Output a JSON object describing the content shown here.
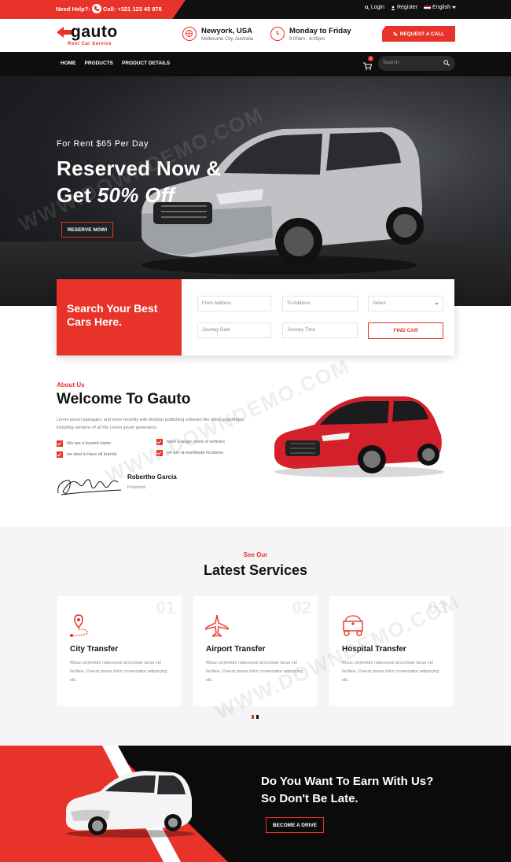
{
  "topbar": {
    "help_label": "Need Help?:",
    "phone": "Call: +321 123 45 978",
    "login": "Login",
    "register": "Register",
    "language": "English"
  },
  "header": {
    "logo_text": "gauto",
    "logo_tagline": "Rent Car Service",
    "location_title": "Newyork, USA",
    "location_sub": "Melbourne City, Australia",
    "hours_title": "Monday to Friday",
    "hours_sub": "9:00am - 6:00pm",
    "request_button": "REQUEST A CALL"
  },
  "nav": {
    "items": [
      "HOME",
      "PRODUCTS",
      "PRODUCT DETAILS"
    ],
    "cart_count": "0",
    "search_placeholder": "Search"
  },
  "hero": {
    "pretitle": "For Rent $65 Per Day",
    "title_line1": "Reserved Now &",
    "title_line2_prefix": "Get ",
    "title_line2_em": "50% Off",
    "button": "RESERVE NOW!"
  },
  "search_box": {
    "heading": "Search Your Best Cars Here.",
    "from": "From Address",
    "to": "To Address",
    "select": "Select",
    "date": "Journey Date",
    "time": "Journey Time",
    "button": "FIND CAR"
  },
  "about": {
    "pretitle": "About Us",
    "title": "Welcome To Gauto",
    "text": "Lorem ipsum passages, and more recently with desktop publishing software like aldus pageMaker including versions of all the Lorem ipsum generators",
    "checks": [
      "We are a trusted name",
      "have a larger stock of vehicles",
      "we deal in have all brands",
      "we are at worldwide locations"
    ],
    "signer_name": "Robertho Garcia",
    "signer_role": "President"
  },
  "services": {
    "pretitle": "See Our",
    "title": "Latest Services",
    "cards": [
      {
        "num": "01",
        "title": "City Transfer",
        "text": "Risus commodo maecenas accumsan lacus vel facilisis. Dorem ipsum dolor consectetur adipiscing elit.",
        "icon": "map-route-icon"
      },
      {
        "num": "02",
        "title": "Airport Transfer",
        "text": "Risus commodo maecenas accumsan lacus vel facilisis. Dorem ipsum dolor consectetur adipiscing elit.",
        "icon": "airplane-icon"
      },
      {
        "num": "03",
        "title": "Hospital Transfer",
        "text": "Risus commodo maecenas accumsan lacus vel facilisis. Dorem ipsum dolor consectetur adipiscing elit.",
        "icon": "hospital-icon"
      }
    ]
  },
  "earn": {
    "line1": "Do You Want To Earn With Us?",
    "line2": "So Don't Be Late.",
    "button": "BECOME A DRIVE"
  },
  "watermark": "WWW.DOWNDEMO.COM",
  "colors": {
    "accent": "#e8332a",
    "dark": "#0e0e0e"
  }
}
